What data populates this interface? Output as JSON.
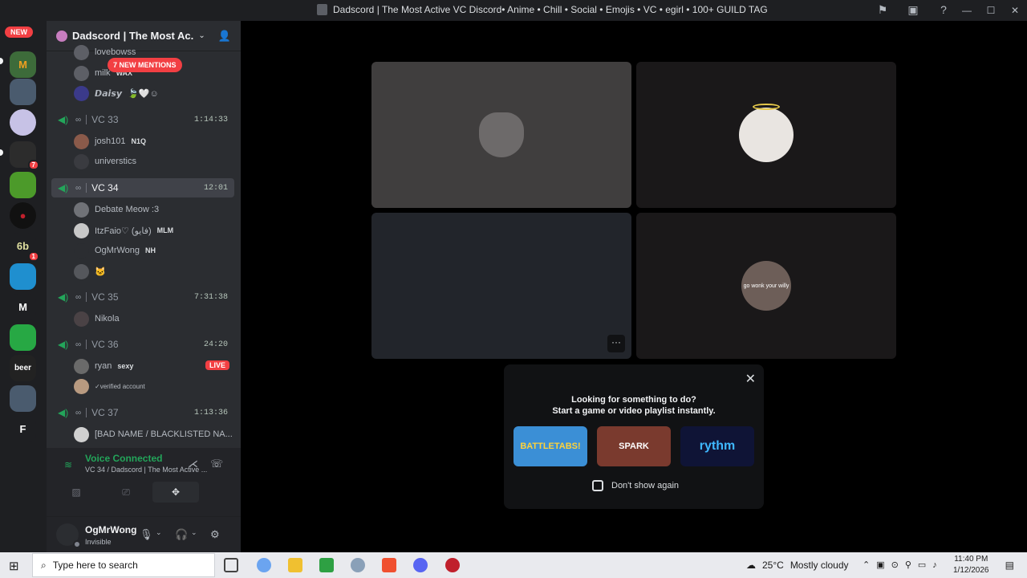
{
  "window": {
    "title": "Dadscord | The Most Active VC Discord• Anime • Chill • Social • Emojis • VC • egirl • 100+ GUILD TAG",
    "minimize": "—",
    "maximize": "☐",
    "close": "✕"
  },
  "guilds": {
    "new_badge": "NEW",
    "badges": [
      "7",
      "1"
    ],
    "letters": [
      "M",
      "F"
    ],
    "text_icons": [
      "beer",
      "6b"
    ]
  },
  "server": {
    "name": "Dadscord | The Most Ac...",
    "mentions": "7 NEW MENTIONS"
  },
  "channels": {
    "top_members": [
      {
        "name": "lovebowss"
      },
      {
        "name": "milk",
        "tag": "WAX"
      },
      {
        "name": "𝘿𝙖𝙞𝙨𝙮",
        "emoji": "🍃🤍☺"
      }
    ],
    "vc33": {
      "name": "VC 33",
      "timer": "1:14:33",
      "members": [
        {
          "name": "josh101",
          "tag": "N1Q"
        },
        {
          "name": "universtics"
        }
      ]
    },
    "vc34": {
      "name": "VC 34",
      "timer": "12:01",
      "members": [
        {
          "name": "Debate Meow :3"
        },
        {
          "name": "ItzFaio♡ (فايو)",
          "tag": "MLM"
        },
        {
          "name": "OgMrWong",
          "tag": "NH"
        },
        {
          "name": "🐱"
        }
      ]
    },
    "vc35": {
      "name": "VC 35",
      "timer": "7:31:38",
      "members": [
        {
          "name": "Nikola"
        }
      ]
    },
    "vc36": {
      "name": "VC 36",
      "timer": "24:20",
      "live": "LIVE",
      "members": [
        {
          "name": "ryan",
          "tag": "sexy"
        },
        {
          "name": "✓verified account"
        }
      ]
    },
    "vc37": {
      "name": "VC 37",
      "timer": "1:13:36",
      "members": [
        {
          "name": "[BAD NAME / BLACKLISTED NA..."
        }
      ]
    }
  },
  "voice": {
    "status": "Voice Connected",
    "location": "VC 34 / Dadscord | The Most Active ..."
  },
  "user": {
    "name": "OgMrWong",
    "status": "Invisible"
  },
  "stage": {
    "tile_caption": "go wonk your willy",
    "more": "···"
  },
  "activity": {
    "line1": "Looking for something to do?",
    "line2": "Start a game or video playlist instantly.",
    "cards": [
      "BATTLETABS!",
      "SPARK",
      "rythm"
    ],
    "checkbox_label": "Don't show again",
    "close": "✕"
  },
  "taskbar": {
    "search_placeholder": "Type here to search",
    "weather_temp": "25°C",
    "weather_desc": "Mostly cloudy",
    "time": "11:40 PM",
    "date": "1/12/2026"
  },
  "colors": {
    "accent_green": "#23a55a",
    "danger_red": "#f23f43",
    "sidebar": "#2b2d31",
    "guild_rail": "#1e1f22"
  }
}
